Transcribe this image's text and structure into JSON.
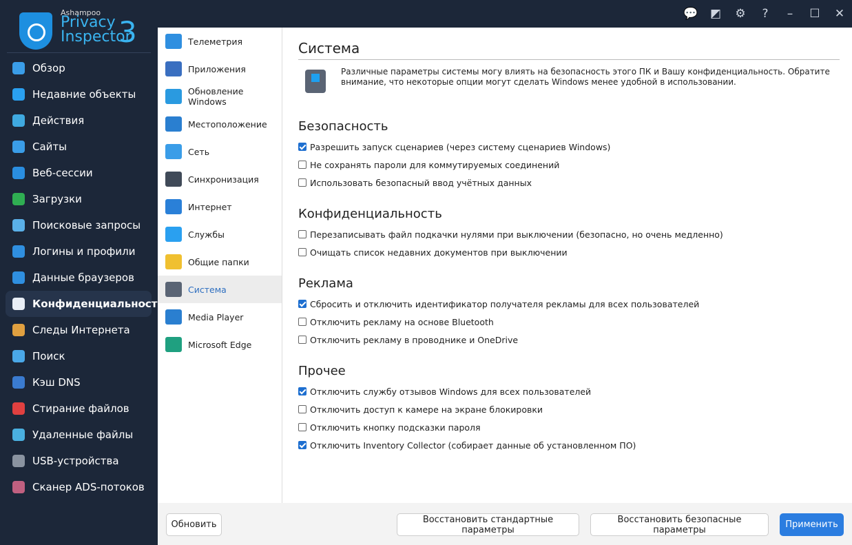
{
  "app": {
    "brand": "Ashampoo",
    "name_line1": "Privacy",
    "name_line2": "Inspector",
    "version": "3"
  },
  "titlebar": {
    "icons": [
      "feedback-icon",
      "skin-icon",
      "settings-icon",
      "help-icon",
      "minimize-icon",
      "maximize-icon",
      "close-icon"
    ]
  },
  "sidebar": {
    "items": [
      {
        "label": "Обзор",
        "color": "#3a9de8"
      },
      {
        "label": "Недавние объекты",
        "color": "#2aa0f0"
      },
      {
        "label": "Действия",
        "color": "#3fa9e0"
      },
      {
        "label": "Сайты",
        "color": "#3a9de8"
      },
      {
        "label": "Веб-сессии",
        "color": "#2a8ee0"
      },
      {
        "label": "Загрузки",
        "color": "#2fae52"
      },
      {
        "label": "Поисковые запросы",
        "color": "#5ab0e8"
      },
      {
        "label": "Логины и профили",
        "color": "#2f8fe0"
      },
      {
        "label": "Данные браузеров",
        "color": "#2f8fe0"
      },
      {
        "label": "Конфиденциальность",
        "color": "#e8eef6",
        "active": true
      },
      {
        "label": "Следы Интернета",
        "color": "#e0a040"
      },
      {
        "label": "Поиск",
        "color": "#4aa8e8"
      },
      {
        "label": "Кэш DNS",
        "color": "#3a7bd0"
      },
      {
        "label": "Стирание файлов",
        "color": "#e04040"
      },
      {
        "label": "Удаленные файлы",
        "color": "#4ab0e0"
      },
      {
        "label": "USB-устройства",
        "color": "#8a93a0"
      },
      {
        "label": "Сканер ADS-потоков",
        "color": "#c06080"
      }
    ]
  },
  "submenu": {
    "items": [
      {
        "label": "Телеметрия",
        "color": "#2f8fe0"
      },
      {
        "label": "Приложения",
        "color": "#3a6fc0"
      },
      {
        "label": "Обновление Windows",
        "color": "#2a9ae0"
      },
      {
        "label": "Местоположение",
        "color": "#2a7fd0"
      },
      {
        "label": "Сеть",
        "color": "#3a9de8"
      },
      {
        "label": "Синхронизация",
        "color": "#404a58"
      },
      {
        "label": "Интернет",
        "color": "#2a80d8"
      },
      {
        "label": "Службы",
        "color": "#2aa0f0"
      },
      {
        "label": "Общие папки",
        "color": "#f0c030"
      },
      {
        "label": "Система",
        "color": "#5a6474",
        "active": true
      },
      {
        "label": "Media Player",
        "color": "#2a7fd0"
      },
      {
        "label": "Microsoft Edge",
        "color": "#1fa080"
      }
    ]
  },
  "main": {
    "title": "Система",
    "intro": "Различные параметры системы могу влиять на безопасность этого ПК и Вашу конфиденциальность. Обратите внимание, что некоторые опции могут сделать Windows менее удобной в использовании.",
    "sections": [
      {
        "title": "Безопасность",
        "options": [
          {
            "label": "Разрешить запуск сценариев (через систему сценариев Windows)",
            "checked": true
          },
          {
            "label": "Не сохранять пароли для коммутируемых соединений",
            "checked": false
          },
          {
            "label": "Использовать безопасный ввод учётных данных",
            "checked": false
          }
        ]
      },
      {
        "title": "Конфиденциальность",
        "options": [
          {
            "label": "Перезаписывать файл подкачки нулями при выключении (безопасно, но очень медленно)",
            "checked": false
          },
          {
            "label": "Очищать список недавних документов при выключении",
            "checked": false
          }
        ]
      },
      {
        "title": "Реклама",
        "options": [
          {
            "label": "Сбросить и отключить идентификатор получателя рекламы для всех пользователей",
            "checked": true
          },
          {
            "label": "Отключить рекламу на основе Bluetooth",
            "checked": false
          },
          {
            "label": "Отключить рекламу в проводнике и OneDrive",
            "checked": false
          }
        ]
      },
      {
        "title": "Прочее",
        "options": [
          {
            "label": "Отключить службу отзывов Windows для всех пользователей",
            "checked": true
          },
          {
            "label": "Отключить доступ к камере на экране блокировки",
            "checked": false
          },
          {
            "label": "Отключить кнопку подсказки пароля",
            "checked": false
          },
          {
            "label": "Отключить Inventory Collector (собирает данные об установленном ПО)",
            "checked": true
          }
        ]
      }
    ]
  },
  "buttons": {
    "refresh": "Обновить",
    "restore_default": "Восстановить стандартные параметры",
    "restore_safe": "Восстановить безопасные параметры",
    "apply": "Применить"
  },
  "colors": {
    "accent": "#2b7de0",
    "sidebar_bg": "#1c2739"
  }
}
